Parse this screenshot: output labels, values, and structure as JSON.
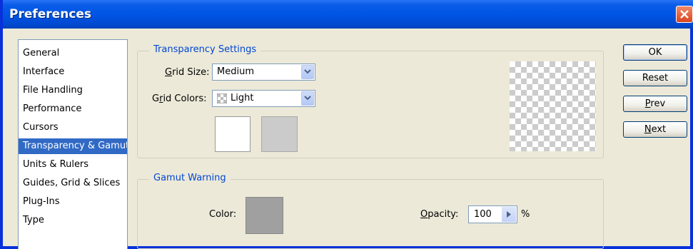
{
  "window": {
    "title": "Preferences"
  },
  "categories": [
    {
      "label": "General"
    },
    {
      "label": "Interface"
    },
    {
      "label": "File Handling"
    },
    {
      "label": "Performance"
    },
    {
      "label": "Cursors"
    },
    {
      "label": "Transparency & Gamut",
      "selected": true
    },
    {
      "label": "Units & Rulers"
    },
    {
      "label": "Guides, Grid & Slices"
    },
    {
      "label": "Plug-Ins"
    },
    {
      "label": "Type"
    }
  ],
  "transparency": {
    "legend": "Transparency Settings",
    "grid_size_label": {
      "accel": "G",
      "rest": "rid Size:"
    },
    "grid_size_value": "Medium",
    "grid_colors_label": {
      "pre": "G",
      "accel": "r",
      "rest": "id Colors:"
    },
    "grid_colors_value": "Light"
  },
  "gamut": {
    "legend": "Gamut Warning",
    "color_label": "Color:",
    "opacity_label": {
      "accel": "O",
      "rest": "pacity:"
    },
    "opacity_value": "100",
    "opacity_unit": "%"
  },
  "buttons": {
    "ok": "OK",
    "reset": "Reset",
    "prev": {
      "accel": "P",
      "rest": "rev"
    },
    "next": {
      "accel": "N",
      "rest": "ext"
    }
  },
  "colors": {
    "title_bar": "#0055e5",
    "selection": "#316ac5",
    "group_legend": "#0046d5",
    "gamut_color": "#a0a0a0"
  }
}
